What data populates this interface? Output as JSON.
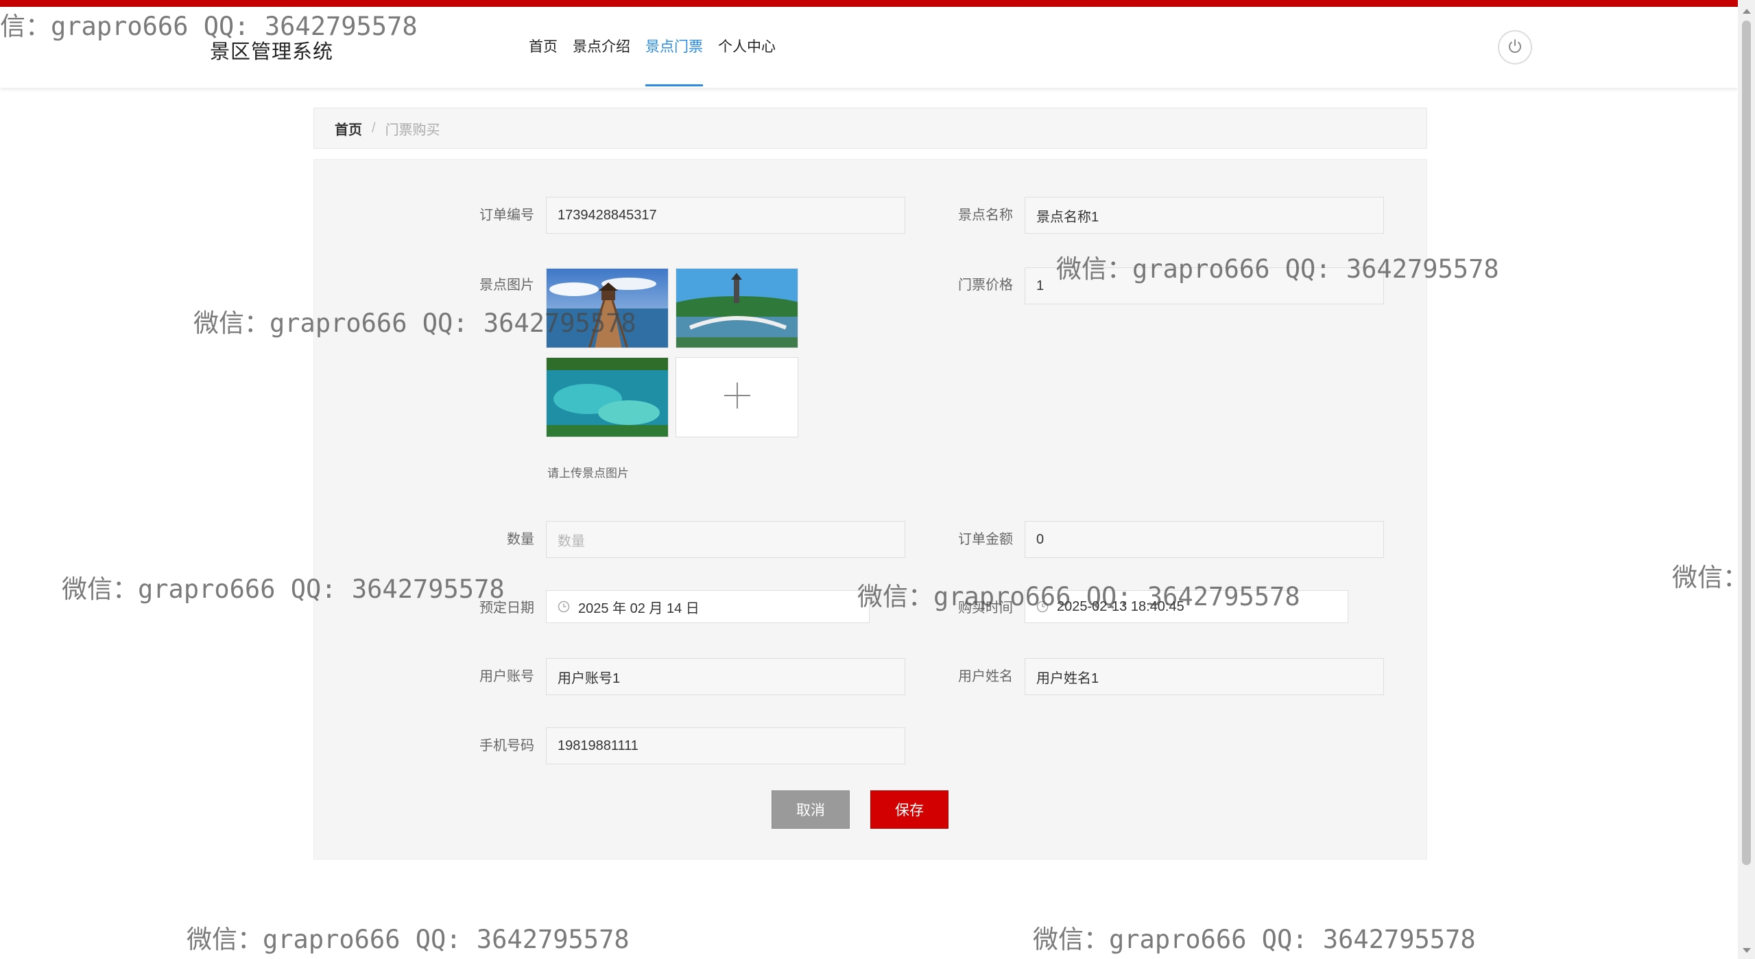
{
  "header": {
    "app_title": "景区管理系统",
    "nav": [
      {
        "label": "首页"
      },
      {
        "label": "景点介绍"
      },
      {
        "label": "景点门票"
      },
      {
        "label": "个人中心"
      }
    ],
    "active_nav": "景点门票",
    "logout_icon": "power-icon"
  },
  "breadcrumb": {
    "home": "首页",
    "separator": "/",
    "current": "门票购买"
  },
  "form": {
    "order_no": {
      "label": "订单编号",
      "value": "1739428845317"
    },
    "scenic_name": {
      "label": "景点名称",
      "value": "景点名称1"
    },
    "scenic_images": {
      "label": "景点图片",
      "tip": "请上传景点图片",
      "add_icon": "plus-icon"
    },
    "ticket_price": {
      "label": "门票价格",
      "value": "1"
    },
    "quantity": {
      "label": "数量",
      "value": "",
      "placeholder": "数量"
    },
    "order_amount": {
      "label": "订单金额",
      "value": "0"
    },
    "booking_date": {
      "label": "预定日期",
      "value": "2025 年 02 月 14 日"
    },
    "purchase_time": {
      "label": "购买时间",
      "value": "2025-02-13 18:40:45"
    },
    "user_account": {
      "label": "用户账号",
      "value": "用户账号1"
    },
    "user_name": {
      "label": "用户姓名",
      "value": "用户姓名1"
    },
    "phone": {
      "label": "手机号码",
      "value": "19819881111"
    }
  },
  "buttons": {
    "cancel": "取消",
    "save": "保存"
  },
  "watermark": {
    "text": "微信：grapro666 QQ: 3642795578",
    "partial_left": "信：grapro666 QQ: 3642795578",
    "partial_right": "微信："
  },
  "colors": {
    "accent": "#2a8be0",
    "brand_red": "#c40000",
    "save_button": "#d30000",
    "cancel_button": "#9a9a9a"
  }
}
